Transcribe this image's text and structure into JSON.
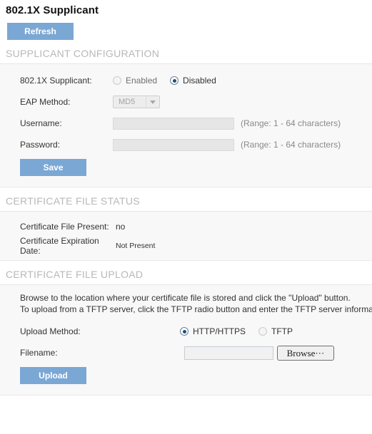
{
  "page": {
    "title": "802.1X Supplicant"
  },
  "toolbar": {
    "refresh_label": "Refresh"
  },
  "supplicant_configuration": {
    "section_title": "SUPPLICANT CONFIGURATION",
    "supplicant_label": "802.1X Supplicant:",
    "supplicant_options": [
      {
        "label": "Enabled",
        "selected": false
      },
      {
        "label": "Disabled",
        "selected": true
      }
    ],
    "eap_method_label": "EAP Method:",
    "eap_method_value": "MD5",
    "username_label": "Username:",
    "username_value": "",
    "username_hint": "(Range: 1 - 64 characters)",
    "password_label": "Password:",
    "password_value": "",
    "password_hint": "(Range: 1 - 64 characters)",
    "save_label": "Save"
  },
  "certificate_file_status": {
    "section_title": "CERTIFICATE FILE STATUS",
    "rows": [
      {
        "label": "Certificate File Present:",
        "value": "no"
      },
      {
        "label": "Certificate Expiration Date:",
        "value": "Not Present"
      }
    ]
  },
  "certificate_file_upload": {
    "section_title": "CERTIFICATE FILE UPLOAD",
    "description_line1": "Browse to the location where your certificate file is stored and click the \"Upload\" button.",
    "description_line2": "To upload from a TFTP server, click the TFTP radio button and enter the TFTP server information.",
    "upload_method_label": "Upload Method:",
    "upload_method_options": [
      {
        "label": "HTTP/HTTPS",
        "selected": true
      },
      {
        "label": "TFTP",
        "selected": false
      }
    ],
    "filename_label": "Filename:",
    "filename_value": "",
    "browse_label": "Browse···",
    "upload_label": "Upload"
  },
  "colors": {
    "button_blue": "#7BA7D4",
    "section_header_gray": "#b8b8b8",
    "panel_bg": "#f8f8f8",
    "radio_dot": "#1f4e79"
  }
}
